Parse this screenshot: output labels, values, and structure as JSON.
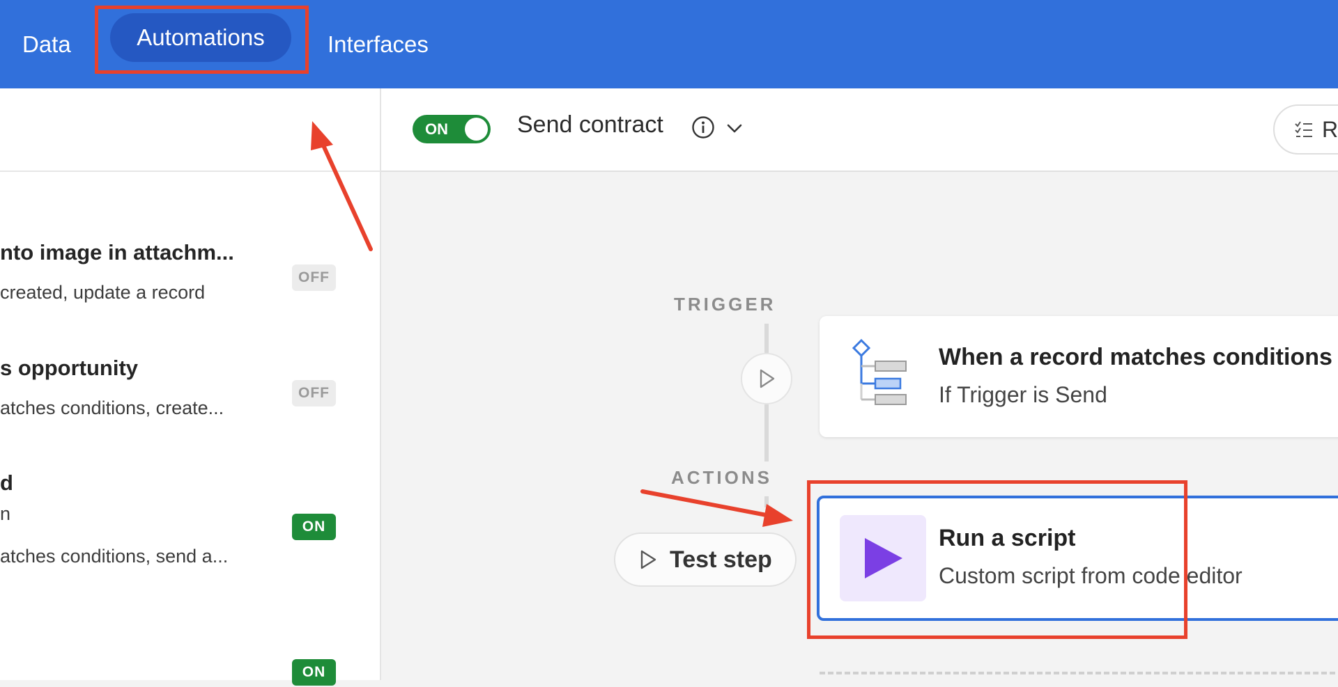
{
  "nav": {
    "tabs": [
      {
        "label": "Data"
      },
      {
        "label": "Automations"
      },
      {
        "label": "Interfaces"
      }
    ]
  },
  "sidebar": {
    "items": [
      {
        "title": "nto image in attachm...",
        "subtitle": " created, update a record",
        "status": "OFF"
      },
      {
        "title": "s opportunity",
        "subtitle": "atches conditions, create...",
        "status": "OFF"
      },
      {
        "title": "d",
        "subtitle": "n",
        "subtitle2": "atches conditions, send a...",
        "status": "ON"
      },
      {
        "status": "ON"
      }
    ]
  },
  "header": {
    "toggle_label": "ON",
    "automation_name": "Send contract",
    "run_history_label": "Ru"
  },
  "canvas": {
    "trigger_label": "TRIGGER",
    "actions_label": "ACTIONS",
    "trigger_card": {
      "title": "When a record matches conditions",
      "subtitle": "If Trigger is Send"
    },
    "test_step_label": "Test step",
    "action_card": {
      "title": "Run a script",
      "subtitle": "Custom script from code editor"
    }
  },
  "colors": {
    "nav_bg": "#3170db",
    "annotation_red": "#e8412c",
    "on_green": "#1e8c39",
    "script_purple": "#7b3fe4"
  }
}
